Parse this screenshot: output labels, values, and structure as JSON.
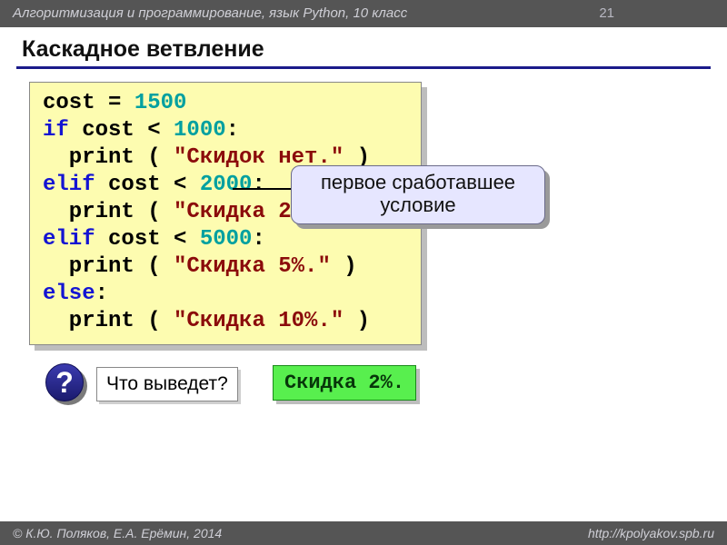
{
  "header": {
    "course": "Алгоритмизация и программирование, язык Python, 10 класс",
    "page_number": "21"
  },
  "title": "Каскадное ветвление",
  "code": {
    "l1a": "cost = ",
    "l1n": "1500",
    "l2a": "if",
    "l2b": " cost < ",
    "l2n": "1000",
    "l2c": ":",
    "l3a": "  print ( ",
    "l3s": "\"Скидок нет.\"",
    "l3b": " )",
    "l4a": "elif",
    "l4b": " cost < ",
    "l4n": "2000",
    "l4c": ":",
    "l5a": "  print ( ",
    "l5s": "\"Скидка 2%.\"",
    "l5b": " )",
    "l6a": "elif",
    "l6b": " cost < ",
    "l6n": "5000",
    "l6c": ":",
    "l7a": "  print ( ",
    "l7s": "\"Скидка 5%.\"",
    "l7b": " )",
    "l8a": "else",
    "l8b": ":",
    "l9a": "  print ( ",
    "l9s": "\"Скидка 10%.\"",
    "l9b": " )"
  },
  "callout": {
    "line1": "первое сработавшее",
    "line2": "условие"
  },
  "question": {
    "mark": "?",
    "text": "Что выведет?"
  },
  "answer": "Скидка 2%.",
  "footer": {
    "left": "© К.Ю. Поляков, Е.А. Ерёмин, 2014",
    "right": "http://kpolyakov.spb.ru"
  }
}
